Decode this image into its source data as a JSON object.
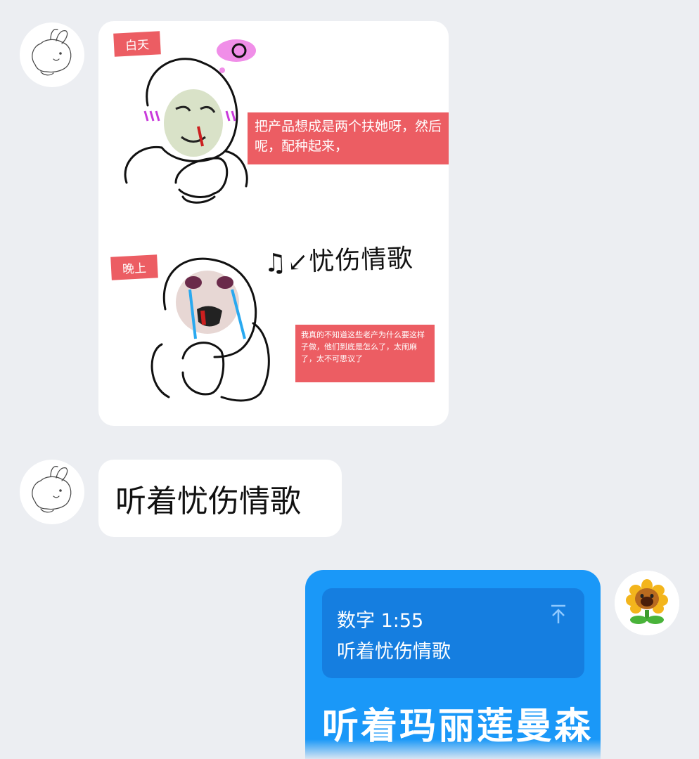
{
  "messages": {
    "meme": {
      "tag_day": "白天",
      "caption_day": "把产品想成是两个扶她呀，然后呢，配种起来，",
      "tag_night": "晚上",
      "scribble": "♫↙忧伤情歌",
      "caption_night": "我真的不知道这些老产为什么要这样子做，他们到底是怎么了，太闹麻了，太不可思议了"
    },
    "incoming_text": "听着忧伤情歌",
    "reply": {
      "quote_header": "数字 1:55",
      "quote_text": "听着忧伤情歌",
      "text": "听着玛丽莲曼森"
    }
  },
  "colors": {
    "background": "#eceef2",
    "bubble_incoming": "#ffffff",
    "bubble_outgoing": "#1a98f8",
    "quote_block": "#157ee0",
    "meme_red": "#ec5d63"
  },
  "icons": {
    "contact_avatar": "bunny-sketch-icon",
    "self_avatar": "sunflower-icon",
    "quote_jump": "arrow-up-icon"
  }
}
